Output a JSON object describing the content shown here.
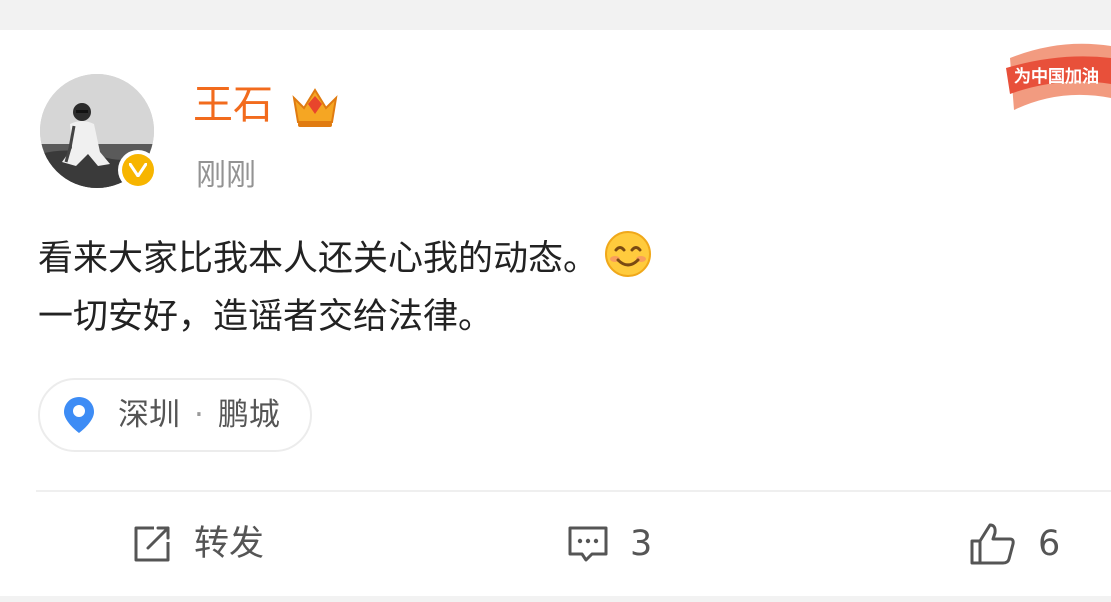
{
  "post": {
    "username": "王石",
    "timestamp": "刚刚",
    "content_lines": [
      "看来大家比我本人还关心我的动态。",
      "一切安好，造谣者交给法律。"
    ],
    "emoji": "smiling-face-emoji",
    "promo_badge_text": "为中国加油",
    "location": {
      "city": "深圳",
      "separator": "·",
      "place": "鹏城"
    }
  },
  "actions": {
    "repost_label": "转发",
    "comment_count": "3",
    "like_count": "6"
  },
  "colors": {
    "username": "#f26b1d",
    "verified_badge": "#f7b500",
    "location_pin": "#3d8cf5"
  }
}
